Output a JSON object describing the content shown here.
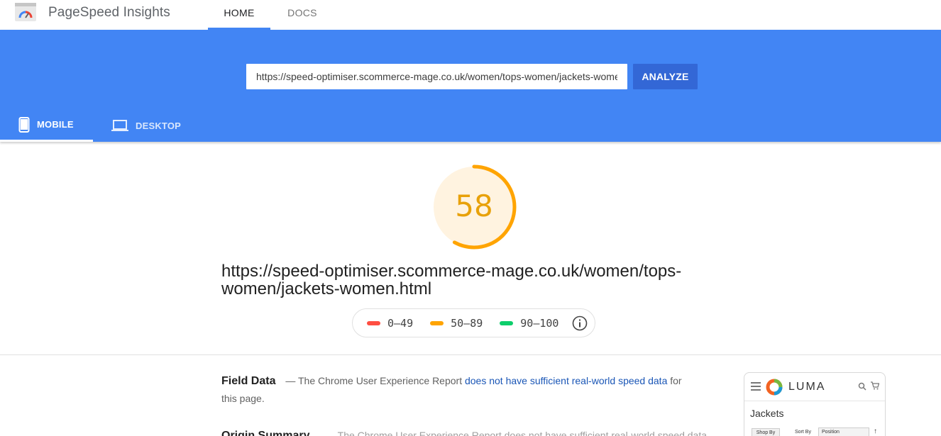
{
  "app": {
    "title": "PageSpeed Insights"
  },
  "nav": {
    "home": "HOME",
    "docs": "DOCS"
  },
  "search": {
    "value": "https://speed-optimiser.scommerce-mage.co.uk/women/tops-women/jackets-women.html",
    "analyze_label": "ANALYZE"
  },
  "device_tabs": {
    "mobile": "MOBILE",
    "desktop": "DESKTOP",
    "selected": "MOBILE"
  },
  "score": {
    "value": "58",
    "fraction": 0.58,
    "color": "#ffa400"
  },
  "page_url": "https://speed-optimiser.scommerce-mage.co.uk/women/tops-women/jackets-women.html",
  "legend": {
    "items": [
      {
        "label": "0–49",
        "color": "#ff4e42"
      },
      {
        "label": "50–89",
        "color": "#ffa400"
      },
      {
        "label": "90–100",
        "color": "#0cce6b"
      }
    ],
    "info_icon": "info-icon"
  },
  "field_data": {
    "title": "Field Data",
    "prefix": "— The Chrome User Experience Report",
    "link": "does not have sufficient real-world speed data",
    "suffix": "for this page."
  },
  "origin_summary": {
    "title": "Origin Summary",
    "text": "— The Chrome User Experience Report does not have sufficient real-world speed data"
  },
  "thumbnail": {
    "brand": "LUMA",
    "heading": "Jackets",
    "shop_by": "Shop By",
    "sort_by": "Sort By",
    "sort_value": "Position"
  }
}
